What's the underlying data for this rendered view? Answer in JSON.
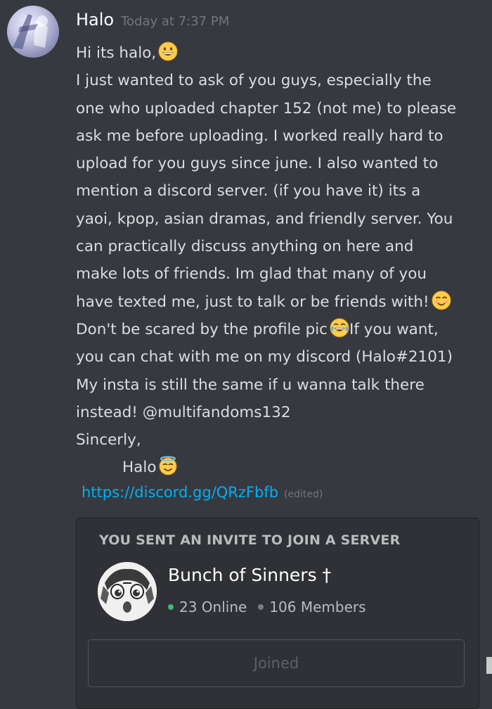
{
  "message": {
    "author": "Halo",
    "timestamp": "Today at 7:37 PM",
    "lines": [
      {
        "text": "Hi its halo,",
        "emoji": "grinning-face-icon"
      },
      {
        "text": "I just wanted to ask of you guys, especially the"
      },
      {
        "text": "one who uploaded chapter 152 (not me) to please"
      },
      {
        "text": "ask me before uploading. I worked really hard to"
      },
      {
        "text": "upload for you guys since june. I also wanted to"
      },
      {
        "text": "mention a discord server. (if you have it) its a"
      },
      {
        "text": "yaoi, kpop, asian dramas, and friendly server. You"
      },
      {
        "text": "can practically discuss anything on here and"
      },
      {
        "text": "make lots of friends. Im glad that many of you"
      },
      {
        "text": "have texted me, just to talk or be friends with!",
        "emoji": "smiling-face-icon"
      },
      {
        "text_before": "Don't be scared by the profile pic",
        "emoji": "tears-of-joy-icon",
        "text_after": "If you want,"
      },
      {
        "text": "you can chat with me on my discord (Halo#2101)"
      },
      {
        "text": "My insta is still the same if u wanna talk there"
      },
      {
        "text": "instead! @multifandoms132"
      },
      {
        "text": "Sincerly,"
      },
      {
        "text": "Halo",
        "emoji": "smiling-halo-icon"
      }
    ],
    "link": "https://discord.gg/QRzFbfb",
    "edited_label": "(edited)"
  },
  "invite": {
    "heading": "YOU SENT AN INVITE TO JOIN A SERVER",
    "server_name": "Bunch of Sinners †",
    "online": "23 Online",
    "members": "106 Members",
    "button_label": "Joined"
  },
  "colors": {
    "background": "#36393f",
    "card": "#2f3136",
    "link": "#00b0f4",
    "online_dot": "#43b581",
    "emoji_yellow": "#ffcc4d"
  }
}
